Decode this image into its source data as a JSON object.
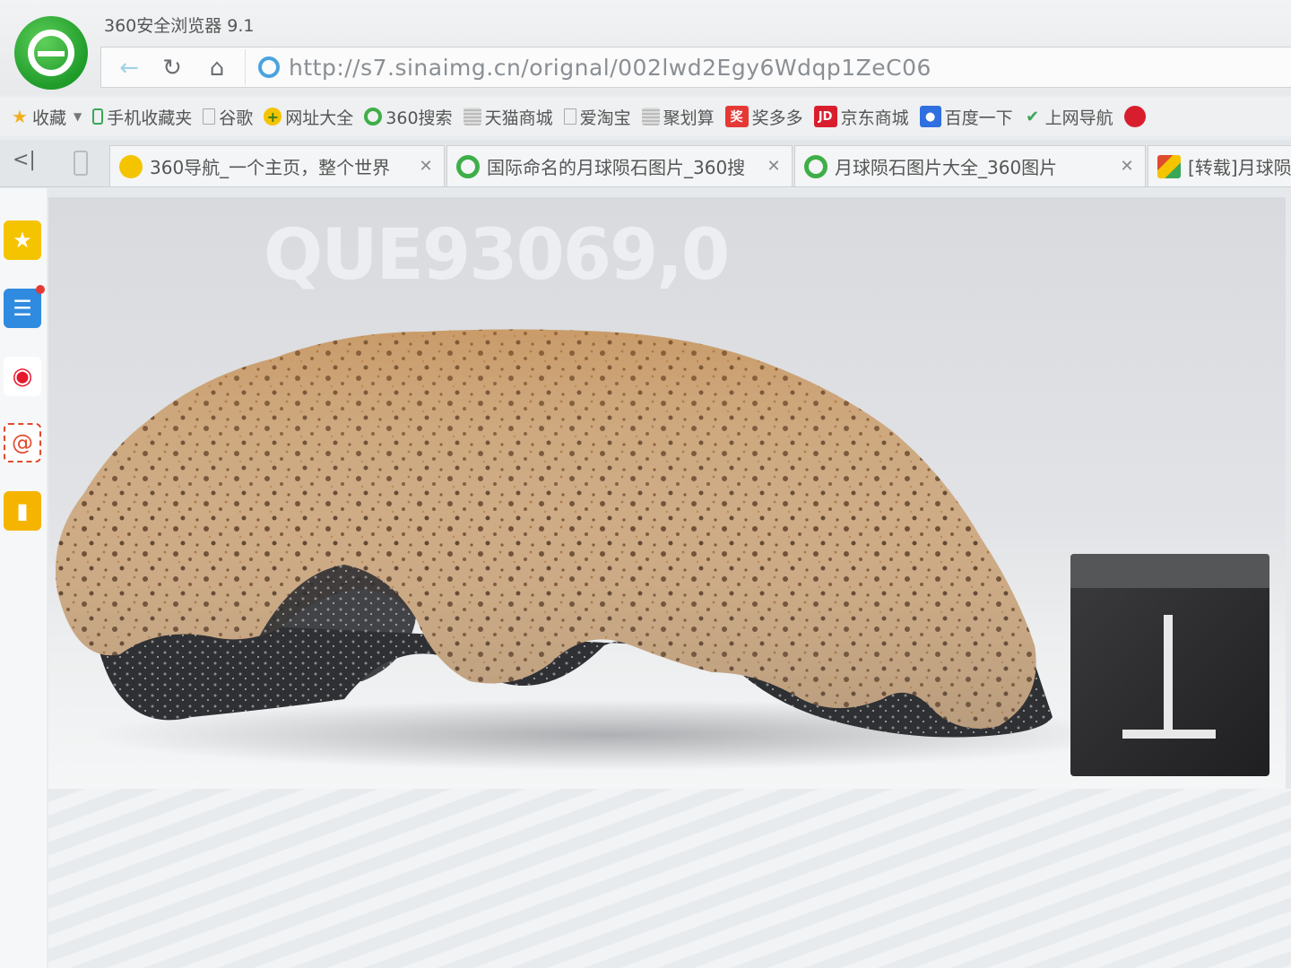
{
  "window": {
    "title": "360安全浏览器 9.1"
  },
  "navigation": {
    "url": "http://s7.sinaimg.cn/orignal/002lwd2Egy6Wdqp1ZeC06"
  },
  "bookmarks": [
    {
      "label": "收藏",
      "icon": "star-icon",
      "color": "#f2b01e"
    },
    {
      "label": "手机收藏夹",
      "icon": "phone-icon",
      "color": "#3aa757"
    },
    {
      "label": "谷歌",
      "icon": "page-icon",
      "color": "#bbbbbb"
    },
    {
      "label": "网址大全",
      "icon": "plus-circle-icon",
      "color": "#f5c400"
    },
    {
      "label": "360搜索",
      "icon": "search-circle-icon",
      "color": "#3fae49"
    },
    {
      "label": "天猫商城",
      "icon": "grid-icon",
      "color": "#b9b9b9"
    },
    {
      "label": "爱淘宝",
      "icon": "page-icon",
      "color": "#bbbbbb"
    },
    {
      "label": "聚划算",
      "icon": "grid-icon",
      "color": "#b9b9b9"
    },
    {
      "label": "奖多多",
      "icon": "jiang-icon",
      "color": "#e53935"
    },
    {
      "label": "京东商城",
      "icon": "jd-icon",
      "color": "#d81e2d"
    },
    {
      "label": "百度一下",
      "icon": "paw-icon",
      "color": "#2f6fe0"
    },
    {
      "label": "上网导航",
      "icon": "hao-icon",
      "color": "#e04a2d"
    }
  ],
  "tabs": [
    {
      "label": "360导航_一个主页，整个世界",
      "icon_color": "#f5c400"
    },
    {
      "label": "国际命名的月球陨石图片_360搜",
      "icon_color": "#3fae49"
    },
    {
      "label": "月球陨石图片大全_360图片",
      "icon_color": "#3fae49"
    },
    {
      "label": "[转载]月球陨",
      "icon_color": "#e04a2d"
    }
  ],
  "sidebar": [
    {
      "icon": "star-icon",
      "color": "#f5c400"
    },
    {
      "icon": "news-icon",
      "color": "#2f8be0"
    },
    {
      "icon": "weibo-icon",
      "color": "#e6162d"
    },
    {
      "icon": "mail-icon",
      "color": "#e04a2d"
    },
    {
      "icon": "note-icon",
      "color": "#f5b400"
    }
  ],
  "image": {
    "specimen_label": "QUE93069,0"
  }
}
